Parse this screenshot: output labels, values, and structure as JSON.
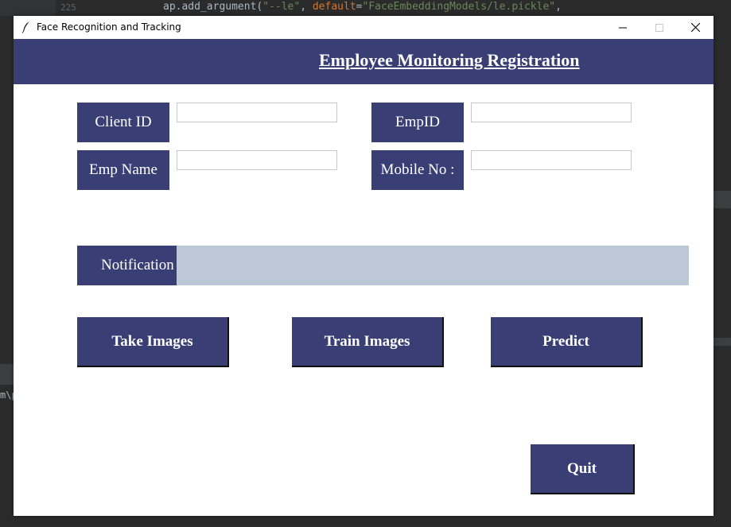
{
  "background": {
    "line_number": "225",
    "code_line": {
      "prefix": "ap.add_argument(",
      "arg1": "\"--le\"",
      "sep": ", ",
      "kw": "default",
      "eq": "=",
      "arg2": "\"FaceEmbeddingModels/le.pickle\"",
      "suffix": ","
    },
    "left_fragment": "m\\p"
  },
  "window": {
    "title": "Face Recognition and Tracking",
    "controls": {
      "minimize": "—",
      "maximize": "☐",
      "close": "✕"
    }
  },
  "header": {
    "title": "Employee Monitoring Registration"
  },
  "form": {
    "client_id": {
      "label": "Client ID",
      "value": "",
      "placeholder": ""
    },
    "emp_id": {
      "label": "EmpID",
      "value": "",
      "placeholder": ""
    },
    "emp_name": {
      "label": "Emp Name",
      "value": "",
      "placeholder": ""
    },
    "mobile_no": {
      "label": "Mobile No :",
      "value": "",
      "placeholder": ""
    }
  },
  "notification": {
    "label": "Notification",
    "message": ""
  },
  "buttons": {
    "take_images": "Take Images",
    "train_images": "Train Images",
    "predict": "Predict",
    "quit": "Quit"
  },
  "colors": {
    "accent": "#393e75",
    "notification_bg": "#bdc8d6",
    "window_bg": "#ffffff"
  }
}
